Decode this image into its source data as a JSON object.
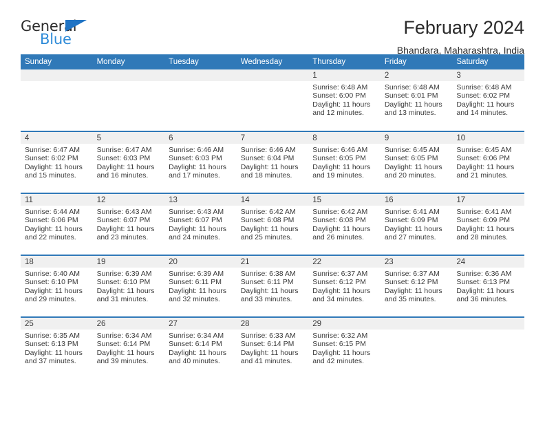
{
  "brand": {
    "name_top": "General",
    "name_bottom": "Blue",
    "accent_color": "#2e8bd8",
    "triangle_color": "#1f73c4"
  },
  "header": {
    "title": "February 2024",
    "subtitle": "Bhandara, Maharashtra, India"
  },
  "theme": {
    "header_row_bg": "#3079b8",
    "daynum_band_bg": "#f0f0f0",
    "text_color": "#3a3a3a"
  },
  "weekday_headers": [
    "Sunday",
    "Monday",
    "Tuesday",
    "Wednesday",
    "Thursday",
    "Friday",
    "Saturday"
  ],
  "weeks": [
    [
      {
        "day": "",
        "lines": []
      },
      {
        "day": "",
        "lines": []
      },
      {
        "day": "",
        "lines": []
      },
      {
        "day": "",
        "lines": []
      },
      {
        "day": "1",
        "lines": [
          "Sunrise: 6:48 AM",
          "Sunset: 6:00 PM",
          "Daylight: 11 hours",
          "and 12 minutes."
        ]
      },
      {
        "day": "2",
        "lines": [
          "Sunrise: 6:48 AM",
          "Sunset: 6:01 PM",
          "Daylight: 11 hours",
          "and 13 minutes."
        ]
      },
      {
        "day": "3",
        "lines": [
          "Sunrise: 6:48 AM",
          "Sunset: 6:02 PM",
          "Daylight: 11 hours",
          "and 14 minutes."
        ]
      }
    ],
    [
      {
        "day": "4",
        "lines": [
          "Sunrise: 6:47 AM",
          "Sunset: 6:02 PM",
          "Daylight: 11 hours",
          "and 15 minutes."
        ]
      },
      {
        "day": "5",
        "lines": [
          "Sunrise: 6:47 AM",
          "Sunset: 6:03 PM",
          "Daylight: 11 hours",
          "and 16 minutes."
        ]
      },
      {
        "day": "6",
        "lines": [
          "Sunrise: 6:46 AM",
          "Sunset: 6:03 PM",
          "Daylight: 11 hours",
          "and 17 minutes."
        ]
      },
      {
        "day": "7",
        "lines": [
          "Sunrise: 6:46 AM",
          "Sunset: 6:04 PM",
          "Daylight: 11 hours",
          "and 18 minutes."
        ]
      },
      {
        "day": "8",
        "lines": [
          "Sunrise: 6:46 AM",
          "Sunset: 6:05 PM",
          "Daylight: 11 hours",
          "and 19 minutes."
        ]
      },
      {
        "day": "9",
        "lines": [
          "Sunrise: 6:45 AM",
          "Sunset: 6:05 PM",
          "Daylight: 11 hours",
          "and 20 minutes."
        ]
      },
      {
        "day": "10",
        "lines": [
          "Sunrise: 6:45 AM",
          "Sunset: 6:06 PM",
          "Daylight: 11 hours",
          "and 21 minutes."
        ]
      }
    ],
    [
      {
        "day": "11",
        "lines": [
          "Sunrise: 6:44 AM",
          "Sunset: 6:06 PM",
          "Daylight: 11 hours",
          "and 22 minutes."
        ]
      },
      {
        "day": "12",
        "lines": [
          "Sunrise: 6:43 AM",
          "Sunset: 6:07 PM",
          "Daylight: 11 hours",
          "and 23 minutes."
        ]
      },
      {
        "day": "13",
        "lines": [
          "Sunrise: 6:43 AM",
          "Sunset: 6:07 PM",
          "Daylight: 11 hours",
          "and 24 minutes."
        ]
      },
      {
        "day": "14",
        "lines": [
          "Sunrise: 6:42 AM",
          "Sunset: 6:08 PM",
          "Daylight: 11 hours",
          "and 25 minutes."
        ]
      },
      {
        "day": "15",
        "lines": [
          "Sunrise: 6:42 AM",
          "Sunset: 6:08 PM",
          "Daylight: 11 hours",
          "and 26 minutes."
        ]
      },
      {
        "day": "16",
        "lines": [
          "Sunrise: 6:41 AM",
          "Sunset: 6:09 PM",
          "Daylight: 11 hours",
          "and 27 minutes."
        ]
      },
      {
        "day": "17",
        "lines": [
          "Sunrise: 6:41 AM",
          "Sunset: 6:09 PM",
          "Daylight: 11 hours",
          "and 28 minutes."
        ]
      }
    ],
    [
      {
        "day": "18",
        "lines": [
          "Sunrise: 6:40 AM",
          "Sunset: 6:10 PM",
          "Daylight: 11 hours",
          "and 29 minutes."
        ]
      },
      {
        "day": "19",
        "lines": [
          "Sunrise: 6:39 AM",
          "Sunset: 6:10 PM",
          "Daylight: 11 hours",
          "and 31 minutes."
        ]
      },
      {
        "day": "20",
        "lines": [
          "Sunrise: 6:39 AM",
          "Sunset: 6:11 PM",
          "Daylight: 11 hours",
          "and 32 minutes."
        ]
      },
      {
        "day": "21",
        "lines": [
          "Sunrise: 6:38 AM",
          "Sunset: 6:11 PM",
          "Daylight: 11 hours",
          "and 33 minutes."
        ]
      },
      {
        "day": "22",
        "lines": [
          "Sunrise: 6:37 AM",
          "Sunset: 6:12 PM",
          "Daylight: 11 hours",
          "and 34 minutes."
        ]
      },
      {
        "day": "23",
        "lines": [
          "Sunrise: 6:37 AM",
          "Sunset: 6:12 PM",
          "Daylight: 11 hours",
          "and 35 minutes."
        ]
      },
      {
        "day": "24",
        "lines": [
          "Sunrise: 6:36 AM",
          "Sunset: 6:13 PM",
          "Daylight: 11 hours",
          "and 36 minutes."
        ]
      }
    ],
    [
      {
        "day": "25",
        "lines": [
          "Sunrise: 6:35 AM",
          "Sunset: 6:13 PM",
          "Daylight: 11 hours",
          "and 37 minutes."
        ]
      },
      {
        "day": "26",
        "lines": [
          "Sunrise: 6:34 AM",
          "Sunset: 6:14 PM",
          "Daylight: 11 hours",
          "and 39 minutes."
        ]
      },
      {
        "day": "27",
        "lines": [
          "Sunrise: 6:34 AM",
          "Sunset: 6:14 PM",
          "Daylight: 11 hours",
          "and 40 minutes."
        ]
      },
      {
        "day": "28",
        "lines": [
          "Sunrise: 6:33 AM",
          "Sunset: 6:14 PM",
          "Daylight: 11 hours",
          "and 41 minutes."
        ]
      },
      {
        "day": "29",
        "lines": [
          "Sunrise: 6:32 AM",
          "Sunset: 6:15 PM",
          "Daylight: 11 hours",
          "and 42 minutes."
        ]
      },
      {
        "day": "",
        "lines": []
      },
      {
        "day": "",
        "lines": []
      }
    ]
  ]
}
